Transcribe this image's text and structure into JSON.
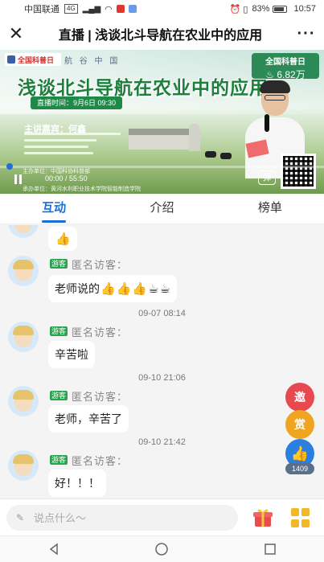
{
  "status_bar": {
    "carrier": "中国联通",
    "network": "4G",
    "battery": "83%",
    "time": "10:57"
  },
  "title_bar": {
    "title": "直播 | 浅谈北斗导航在农业中的应用"
  },
  "video": {
    "org_left": "全国科普日",
    "org_right": "航 谷 中 国",
    "badge_title": "全国科普日",
    "view_count": "6.82万",
    "headline": "浅谈北斗导航在农业中的应用",
    "live_time": "直播时间：9月6日 09:30",
    "speaker": "主讲嘉宾：何鑫",
    "organizer_line": "主办单位：中国科协科普部",
    "host_line": "承办单位：黄河水利职业技术学院智能制造学院",
    "current_time": "00:00",
    "duration": "55:50",
    "progress": 0.0,
    "danmu_label": "弹"
  },
  "tabs": [
    "互动",
    "介绍",
    "榜单"
  ],
  "active_tab": 0,
  "chat": {
    "guest_tag": "游客",
    "messages": [
      {
        "sender": "",
        "text": "",
        "emojis": [
          "👍"
        ],
        "timestamp": ""
      },
      {
        "sender": "匿名访客：",
        "text": "老师说的",
        "emojis": [
          "👍",
          "👍",
          "👍",
          "☕",
          "☕"
        ],
        "timestamp": "09-07 08:14"
      },
      {
        "sender": "匿名访客：",
        "text": "辛苦啦",
        "emojis": [],
        "timestamp": "09-10 21:06"
      },
      {
        "sender": "匿名访客：",
        "text": "老师，辛苦了",
        "emojis": [],
        "timestamp": "09-10 21:42"
      },
      {
        "sender": "匿名访客：",
        "text": "好！！！",
        "emojis": [],
        "timestamp": ""
      }
    ]
  },
  "floating": {
    "invite": "邀",
    "reward": "赏",
    "like_count": "1409"
  },
  "input": {
    "placeholder": "说点什么～"
  },
  "colors": {
    "accent": "#1a6ed8",
    "guest_tag": "#2aa44f",
    "invite": "#e8484f",
    "reward": "#f0a520",
    "like": "#2b7fe0"
  }
}
